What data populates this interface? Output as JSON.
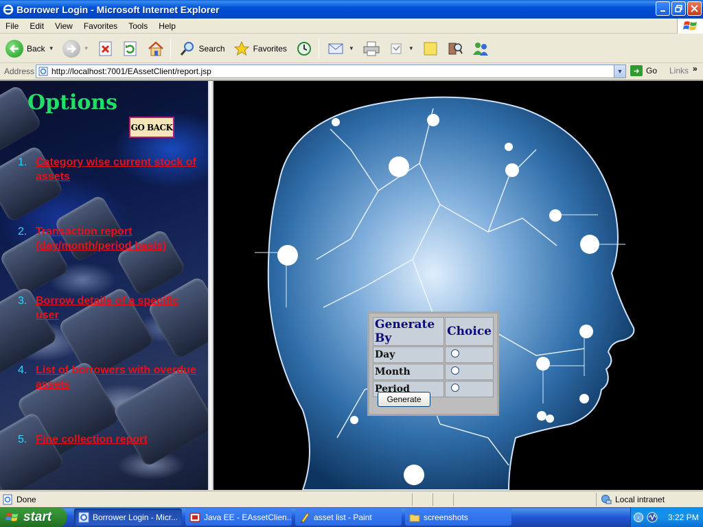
{
  "window": {
    "title": "Borrower Login - Microsoft Internet Explorer",
    "controls": [
      "minimize",
      "maximize",
      "close"
    ]
  },
  "menubar": {
    "items": [
      "File",
      "Edit",
      "View",
      "Favorites",
      "Tools",
      "Help"
    ]
  },
  "toolbar": {
    "back_label": "Back",
    "search_label": "Search",
    "favorites_label": "Favorites"
  },
  "address": {
    "label": "Address",
    "url": "http://localhost:7001/EAssetClient/report.jsp",
    "go_label": "Go",
    "links_label": "Links"
  },
  "left_panel": {
    "title": "Options",
    "go_back_label": "GO BACK",
    "options": [
      {
        "number": "1.",
        "label": "Category wise current stock of assets"
      },
      {
        "number": "2.",
        "label": "Transaction report (day/month/period basis)"
      },
      {
        "number": "3.",
        "label": "Borrow details of a specific user"
      },
      {
        "number": "4.",
        "label": "List of borrowers with overdue assets"
      },
      {
        "number": "5.",
        "label": "Fine collection report"
      }
    ]
  },
  "choice_form": {
    "header_left": "Generate By",
    "header_right": "Choice",
    "rows": [
      "Day",
      "Month",
      "Period"
    ],
    "generate_label": "Generate"
  },
  "statusbar": {
    "status": "Done",
    "zone": "Local intranet"
  },
  "taskbar": {
    "start_label": "start",
    "tasks": [
      "Borrower Login - Micr...",
      "Java EE - EAssetClien...",
      "asset list - Paint",
      "screenshots"
    ],
    "clock": "3:22 PM"
  },
  "colors": {
    "options_title": "#22dd66",
    "option_link": "#e8101a",
    "option_number": "#2fd6ff",
    "choice_header": "#0a0a7a"
  }
}
